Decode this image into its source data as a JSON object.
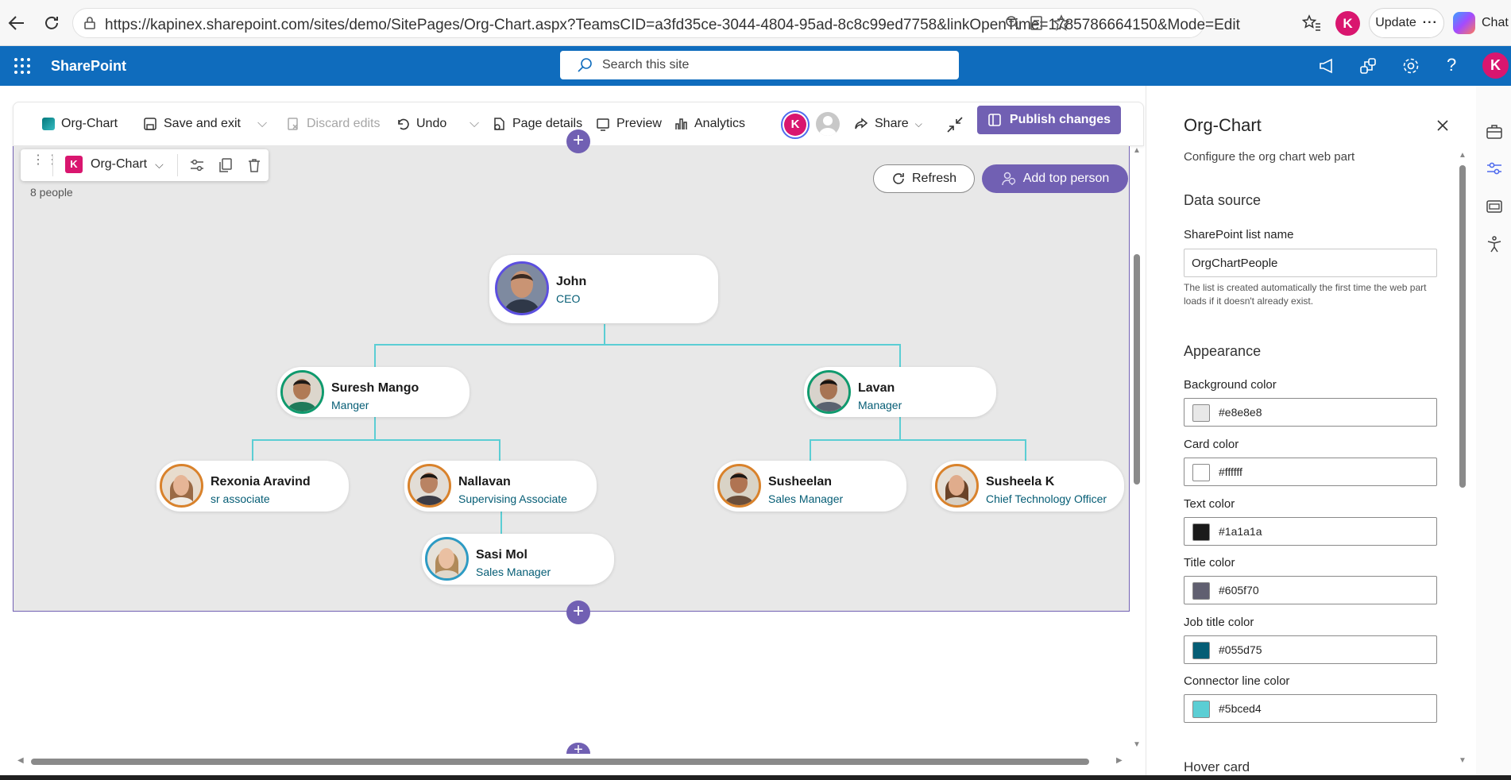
{
  "browser": {
    "url": "https://kapinex.sharepoint.com/sites/demo/SitePages/Org-Chart.aspx?TeamsCID=a3fd35ce-3044-4804-95ad-8c8c99ed7758&linkOpenTime=1785786664150&Mode=Edit",
    "update_label": "Update",
    "chat_label": "Chat"
  },
  "suite": {
    "app_name": "SharePoint",
    "search_placeholder": "Search this site"
  },
  "command_bar": {
    "page_name": "Org-Chart",
    "save_exit": "Save and exit",
    "discard": "Discard edits",
    "undo": "Undo",
    "page_details": "Page details",
    "preview": "Preview",
    "analytics": "Analytics",
    "share": "Share",
    "publish": "Publish changes"
  },
  "webpart": {
    "toolbar_name": "Org-Chart",
    "people_count": "8 people",
    "refresh": "Refresh",
    "add_top": "Add top person"
  },
  "people": [
    {
      "name": "John",
      "title": "CEO"
    },
    {
      "name": "Suresh Mango",
      "title": "Manger"
    },
    {
      "name": "Lavan",
      "title": "Manager"
    },
    {
      "name": "Rexonia Aravind",
      "title": "sr associate"
    },
    {
      "name": "Nallavan",
      "title": "Supervising Associate"
    },
    {
      "name": "Sasi Mol",
      "title": "Sales Manager"
    },
    {
      "name": "Susheelan",
      "title": "Sales Manager"
    },
    {
      "name": "Susheela K",
      "title": "Chief Technology Officer"
    }
  ],
  "panel": {
    "title": "Org-Chart",
    "subtitle": "Configure the org chart web part",
    "data_source": "Data source",
    "list_label": "SharePoint list name",
    "list_value": "OrgChartPeople",
    "list_help": "The list is created automatically the first time the web part loads if it doesn't already exist.",
    "appearance": "Appearance",
    "hover_card": "Hover card",
    "colors": [
      {
        "label": "Background color",
        "value": "#e8e8e8"
      },
      {
        "label": "Card color",
        "value": "#ffffff"
      },
      {
        "label": "Text color",
        "value": "#1a1a1a"
      },
      {
        "label": "Title color",
        "value": "#605f70"
      },
      {
        "label": "Job title color",
        "value": "#055d75"
      },
      {
        "label": "Connector line color",
        "value": "#5bced4"
      }
    ]
  }
}
